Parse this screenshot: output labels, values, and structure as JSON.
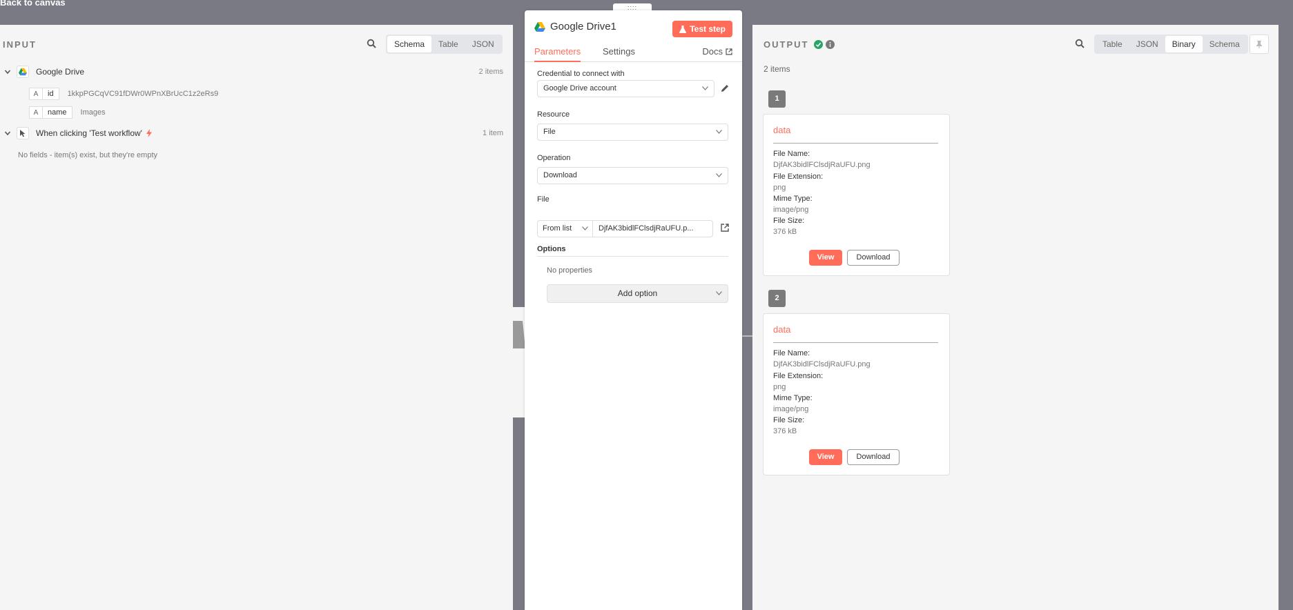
{
  "nav": {
    "back_label": "Back to canvas"
  },
  "input": {
    "title": "INPUT",
    "tabs": [
      "Schema",
      "Table",
      "JSON"
    ],
    "active_tab": "Schema",
    "nodes": [
      {
        "name": "Google Drive",
        "count": "2 items",
        "fields": [
          {
            "type": "A",
            "key": "id",
            "value": "1kkpPGCqVC91fDWr0WPnXBrUcC1z2eRs9"
          },
          {
            "type": "A",
            "key": "name",
            "value": "Images"
          }
        ]
      },
      {
        "name": "When clicking 'Test workflow'",
        "count": "1 item",
        "empty_note": "No fields - item(s) exist, but they're empty"
      }
    ]
  },
  "node": {
    "title": "Google Drive1",
    "test_label": "Test step",
    "tabs": [
      "Parameters",
      "Settings"
    ],
    "docs_label": "Docs",
    "credential_label": "Credential to connect with",
    "credential_value": "Google Drive account",
    "resource_label": "Resource",
    "resource_value": "File",
    "operation_label": "Operation",
    "operation_value": "Download",
    "file_label": "File",
    "file_mode": "From list",
    "file_value": "DjfAK3bidlFClsdjRaUFU.p...",
    "options_label": "Options",
    "no_properties": "No properties",
    "add_option": "Add option"
  },
  "output": {
    "title": "OUTPUT",
    "tabs": [
      "Table",
      "JSON",
      "Binary",
      "Schema"
    ],
    "active_tab": "Binary",
    "items_count": "2 items",
    "items": [
      {
        "index": "1",
        "title": "data",
        "file_name_label": "File Name:",
        "file_name": "DjfAK3bidlFClsdjRaUFU.png",
        "file_ext_label": "File Extension:",
        "file_ext": "png",
        "mime_label": "Mime Type:",
        "mime": "image/png",
        "size_label": "File Size:",
        "size": "376 kB",
        "view_label": "View",
        "download_label": "Download"
      },
      {
        "index": "2",
        "title": "data",
        "file_name_label": "File Name:",
        "file_name": "DjfAK3bidlFClsdjRaUFU.png",
        "file_ext_label": "File Extension:",
        "file_ext": "png",
        "mime_label": "Mime Type:",
        "mime": "image/png",
        "size_label": "File Size:",
        "size": "376 kB",
        "view_label": "View",
        "download_label": "Download"
      }
    ]
  },
  "colors": {
    "accent": "#ff6d5a",
    "success": "#29a568",
    "backdrop": "#7a7a85"
  },
  "icons": {
    "search": "search-icon",
    "chevron": "chevron-down-icon",
    "drive": "google-drive-icon",
    "pointer": "cursor-pointer-icon",
    "bolt": "lightning-icon",
    "flask": "flask-icon",
    "external": "external-link-icon",
    "pencil": "pencil-icon",
    "check": "check-circle-icon",
    "info": "info-icon",
    "pin": "pin-icon"
  }
}
